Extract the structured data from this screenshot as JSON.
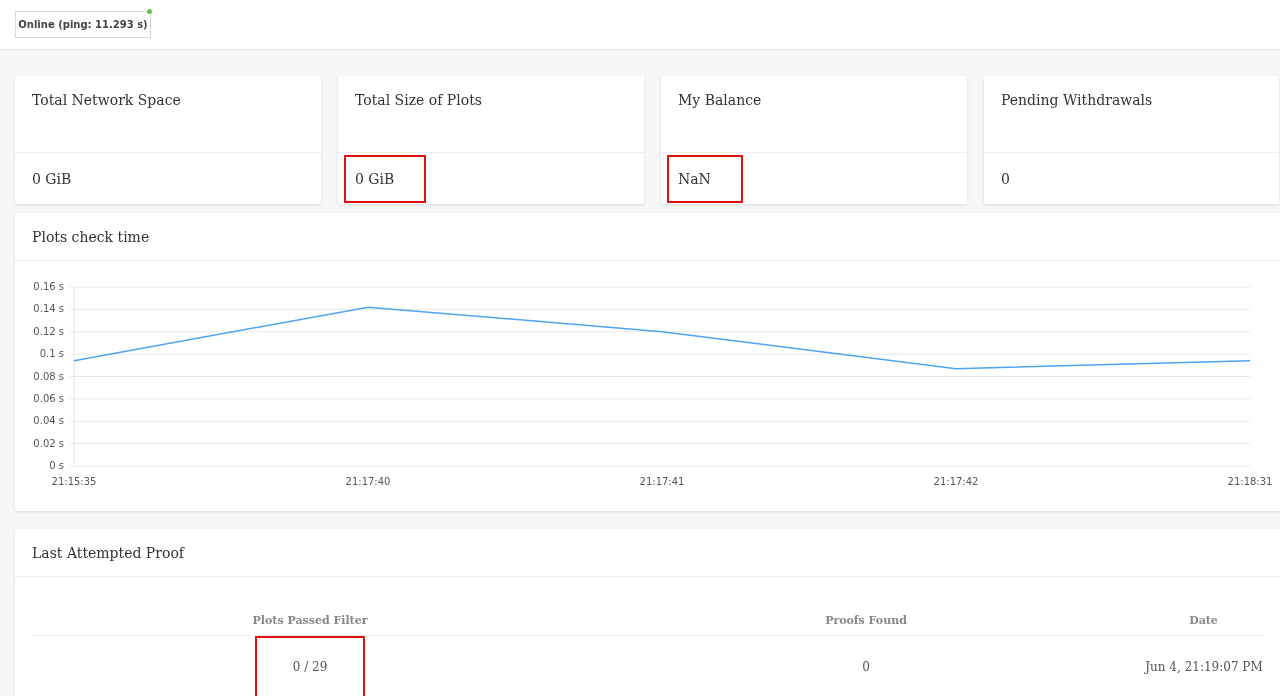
{
  "status": {
    "label": "Online (ping: 11.293 s)",
    "online": true
  },
  "cards": [
    {
      "title": "Total Network Space",
      "value": "0 GiB",
      "highlighted": false
    },
    {
      "title": "Total Size of Plots",
      "value": "0 GiB",
      "highlighted": true
    },
    {
      "title": "My Balance",
      "value": "NaN",
      "highlighted": true
    },
    {
      "title": "Pending Withdrawals",
      "value": "0",
      "highlighted": false
    }
  ],
  "plots_check": {
    "title": "Plots check time",
    "chart_data": {
      "type": "line",
      "categories": [
        "21:15:35",
        "21:17:40",
        "21:17:41",
        "21:17:42",
        "21:18:31"
      ],
      "series": [
        {
          "color": "#4fa3f0",
          "values": [
            0.094,
            0.142,
            0.12,
            0.087,
            0.094
          ]
        }
      ],
      "grid": true,
      "ylim": [
        0,
        0.16
      ],
      "yticks": [
        {
          "value": 0,
          "label": "0 s"
        },
        {
          "value": 0.02,
          "label": "0.02 s"
        },
        {
          "value": 0.04,
          "label": "0.04 s"
        },
        {
          "value": 0.06,
          "label": "0.06 s"
        },
        {
          "value": 0.08,
          "label": "0.08 s"
        },
        {
          "value": 0.1,
          "label": "0.1 s"
        },
        {
          "value": 0.12,
          "label": "0.12 s"
        },
        {
          "value": 0.14,
          "label": "0.14 s"
        },
        {
          "value": 0.16,
          "label": "0.16 s"
        }
      ]
    }
  },
  "last_proof": {
    "title": "Last Attempted Proof",
    "columns": [
      "Plots Passed Filter",
      "Proofs Found",
      "Date"
    ],
    "rows": [
      {
        "cells": [
          {
            "text": "0 / 29",
            "highlighted": true
          },
          {
            "text": "0",
            "highlighted": false
          },
          {
            "text": "Jun 4, 21:19:07 PM",
            "highlighted": false
          }
        ]
      }
    ]
  }
}
